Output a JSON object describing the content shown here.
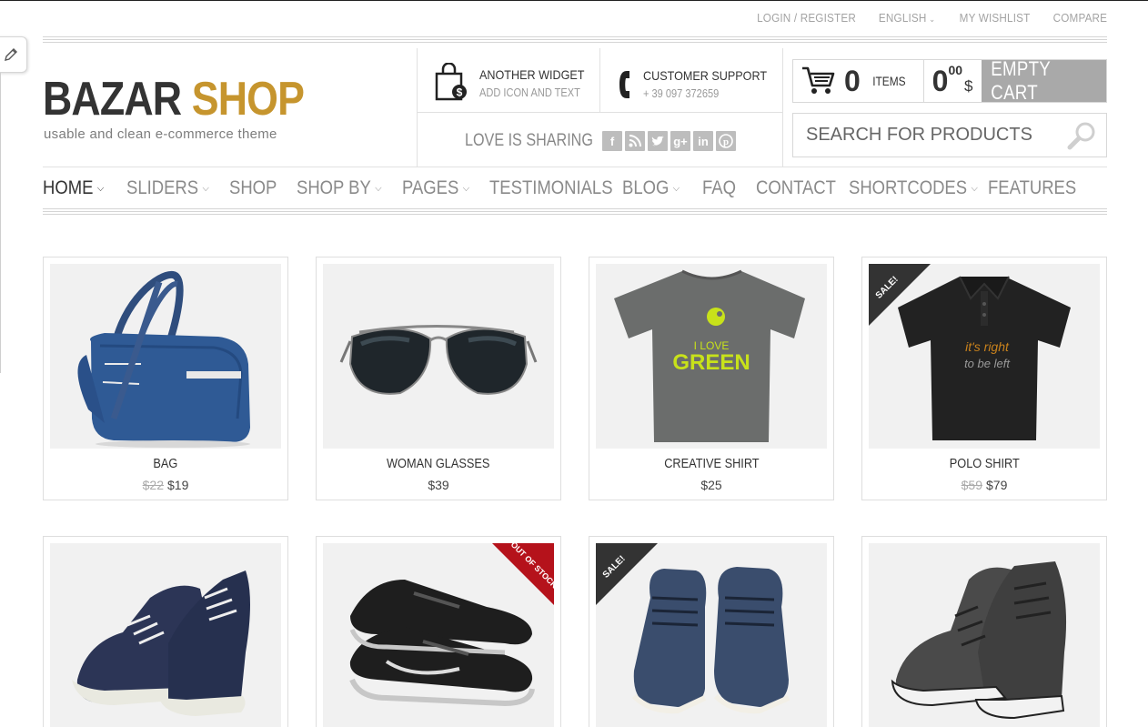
{
  "topbar": {
    "login": "LOGIN / REGISTER",
    "language": "ENGLISH",
    "wishlist": "MY WISHLIST",
    "compare": "COMPARE"
  },
  "logo": {
    "word1": "BAZAR",
    "word2": "SHOP",
    "tagline": "usable and clean e-commerce theme"
  },
  "widgets": {
    "another": {
      "title": "ANOTHER WIDGET",
      "subtitle": "ADD ICON AND TEXT",
      "icon": "shopping-bag-dollar-icon"
    },
    "support": {
      "title": "CUSTOMER SUPPORT",
      "subtitle": "+ 39 097 372659",
      "icon": "phone-icon"
    },
    "sharing": {
      "label": "LOVE IS SHARING",
      "icons": [
        "facebook-icon",
        "rss-icon",
        "twitter-icon",
        "google-plus-icon",
        "linkedin-icon",
        "pinterest-icon"
      ]
    }
  },
  "cart": {
    "count": "0",
    "items_label": "ITEMS",
    "total": "0",
    "total_cents": "00",
    "currency": "$",
    "empty_label": "EMPTY CART"
  },
  "search": {
    "placeholder": "SEARCH FOR PRODUCTS"
  },
  "nav": [
    {
      "label": "HOME",
      "dropdown": true,
      "active": true
    },
    {
      "label": "SLIDERS",
      "dropdown": true
    },
    {
      "label": "SHOP",
      "dropdown": false
    },
    {
      "label": "SHOP BY",
      "dropdown": true
    },
    {
      "label": "PAGES",
      "dropdown": true
    },
    {
      "label": "TESTIMONIALS",
      "dropdown": false
    },
    {
      "label": "BLOG",
      "dropdown": true
    },
    {
      "label": "FAQ",
      "dropdown": false
    },
    {
      "label": "CONTACT",
      "dropdown": false
    },
    {
      "label": "SHORTCODES",
      "dropdown": true
    },
    {
      "label": "FEATURES",
      "dropdown": false
    }
  ],
  "products": [
    {
      "name": "BAG",
      "old_price": "$22",
      "price": "$19"
    },
    {
      "name": "WOMAN GLASSES",
      "price": "$39"
    },
    {
      "name": "CREATIVE SHIRT",
      "price": "$25",
      "shirt_text_1": "I LOVE",
      "shirt_text_2": "GREEN"
    },
    {
      "name": "POLO SHIRT",
      "old_price": "$59",
      "price": "$79",
      "badge": "SALE!",
      "shirt_text_1": "it's right",
      "shirt_text_2": "to be left"
    },
    {
      "name": ""
    },
    {
      "name": "",
      "badge": "OUT OF STOCK"
    },
    {
      "name": "",
      "badge": "SALE!"
    },
    {
      "name": ""
    }
  ],
  "colors": {
    "accent": "#c6952e",
    "ribbon_dark": "#333333",
    "ribbon_red": "#b5121b",
    "empty_cart_bg": "#a9a9a9"
  }
}
